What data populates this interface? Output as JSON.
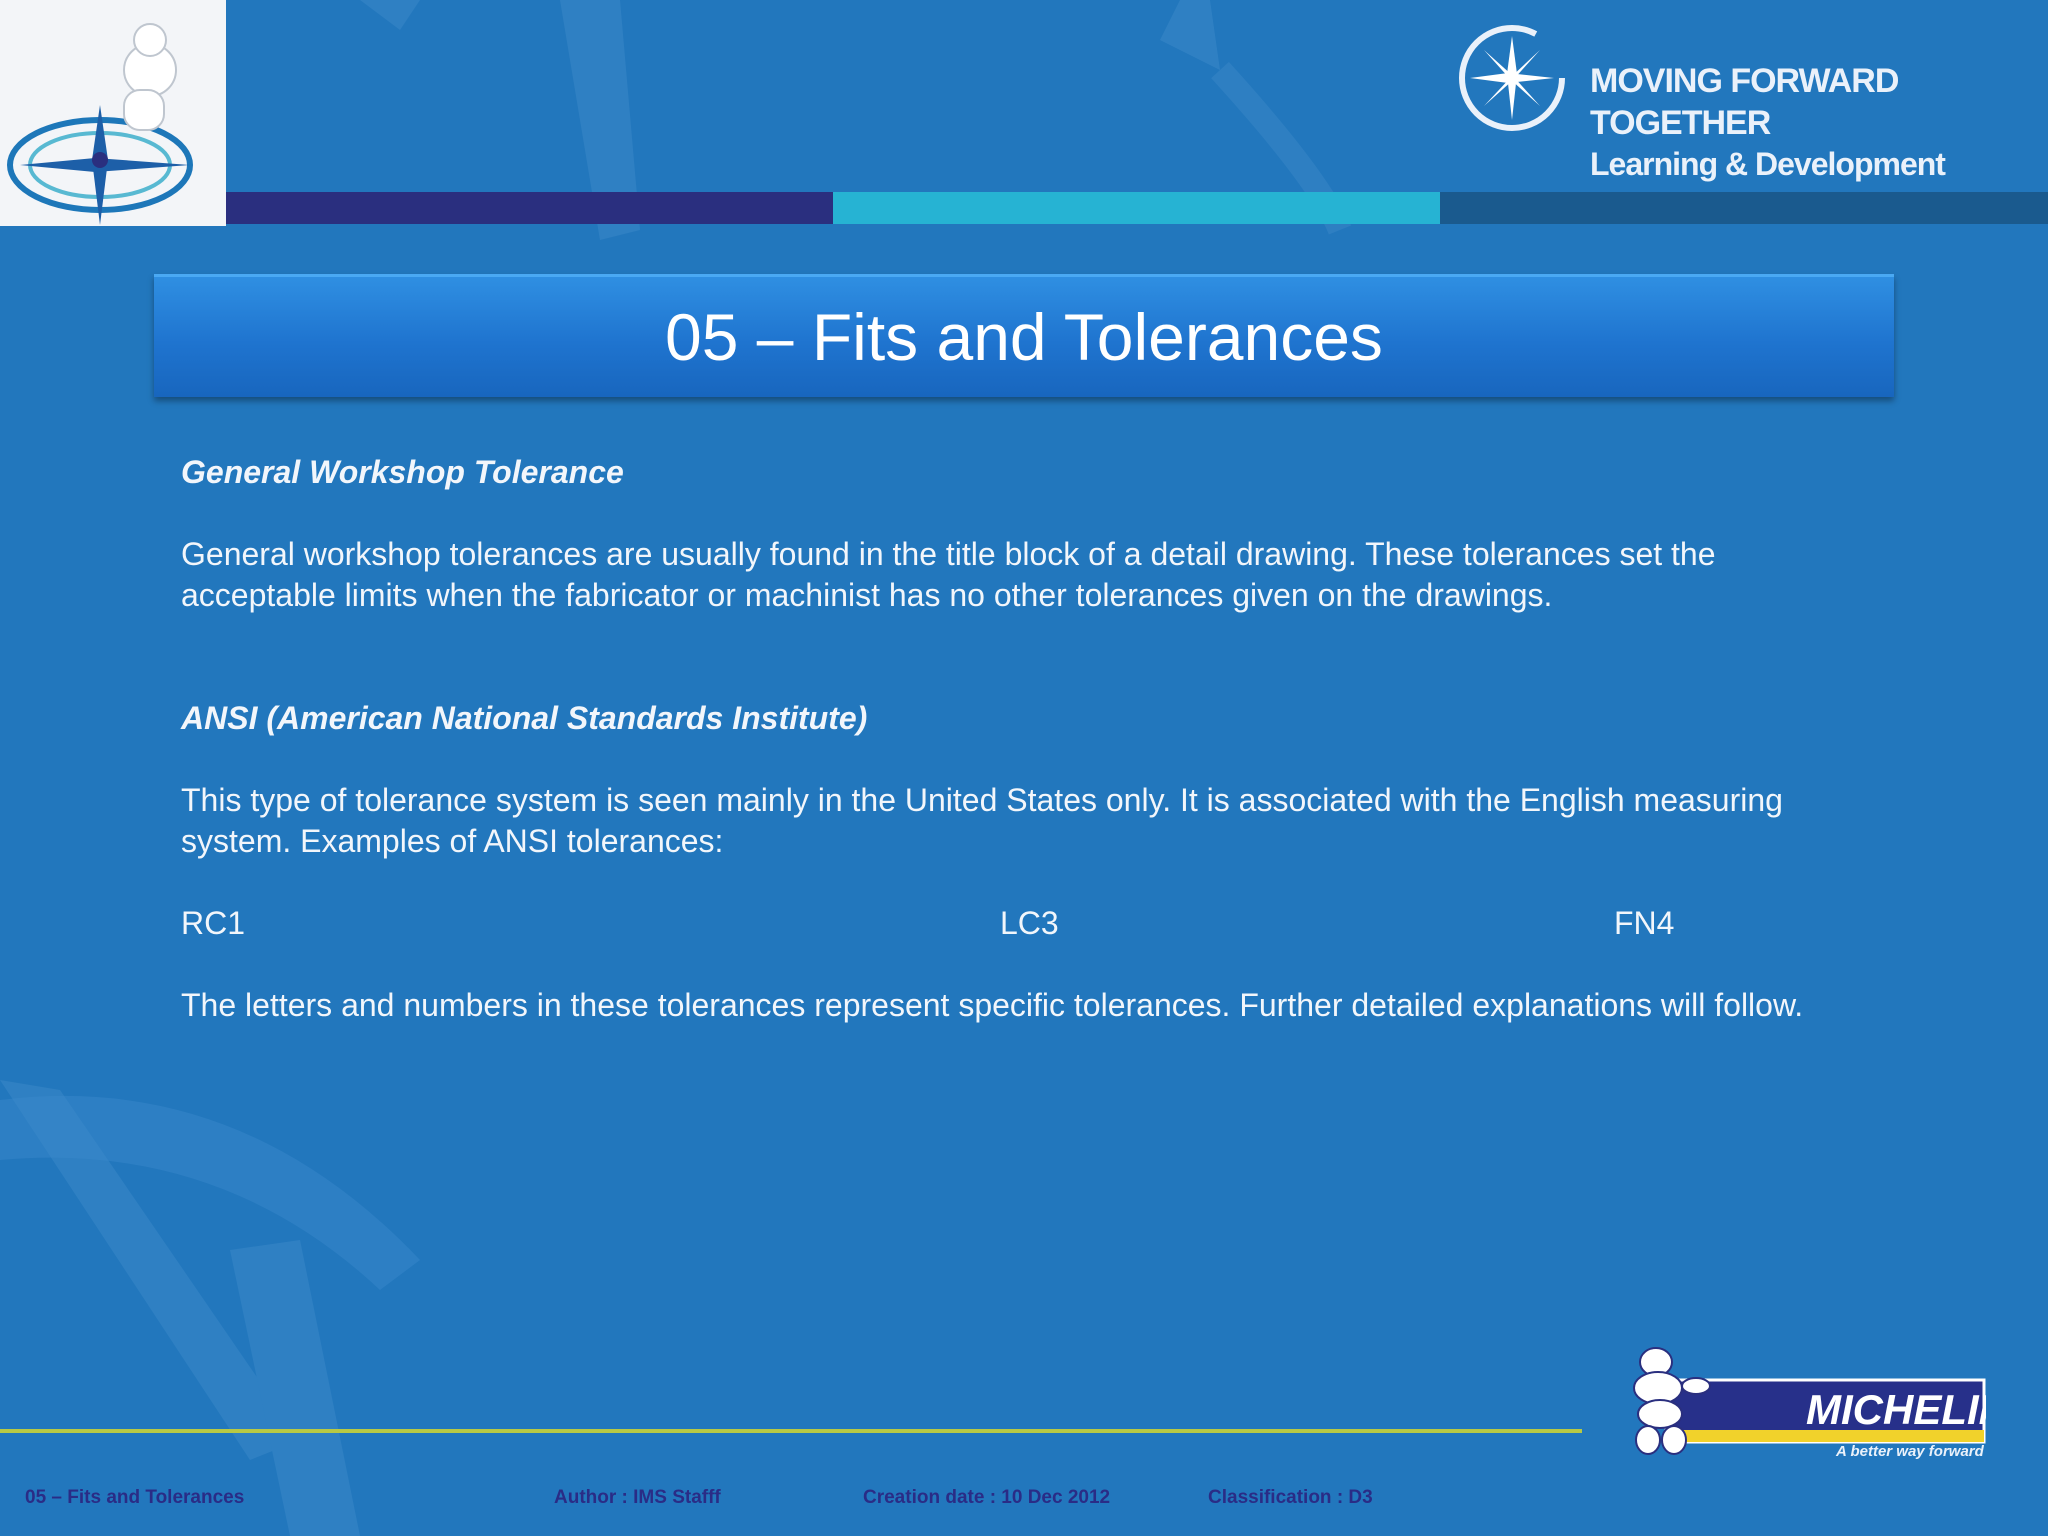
{
  "brand": {
    "line1": "MOVING FORWARD TOGETHER",
    "line2": "Learning & Development"
  },
  "title": "05 – Fits and Tolerances",
  "sections": [
    {
      "heading": "General Workshop Tolerance",
      "body": "General workshop tolerances are usually found in the title block of a detail drawing.  These tolerances set the acceptable limits when the fabricator or machinist has no other tolerances given on the drawings."
    },
    {
      "heading": "ANSI (American National Standards Institute)",
      "body": "This type of tolerance system is seen mainly in the United States only.  It is associated with the English measuring system.  Examples of ANSI tolerances:"
    }
  ],
  "examples": [
    "RC1",
    "LC3",
    "FN4"
  ],
  "closing": "The letters and numbers in these tolerances represent specific tolerances. Further detailed explanations will follow.",
  "logo": {
    "name": "MICHELIN",
    "tagline": "A better way forward"
  },
  "footer": {
    "title": "05 – Fits and Tolerances",
    "author": "Author : IMS Stafff",
    "creation": "Creation date : 10 Dec 2012",
    "classification": "Classification : D3"
  }
}
